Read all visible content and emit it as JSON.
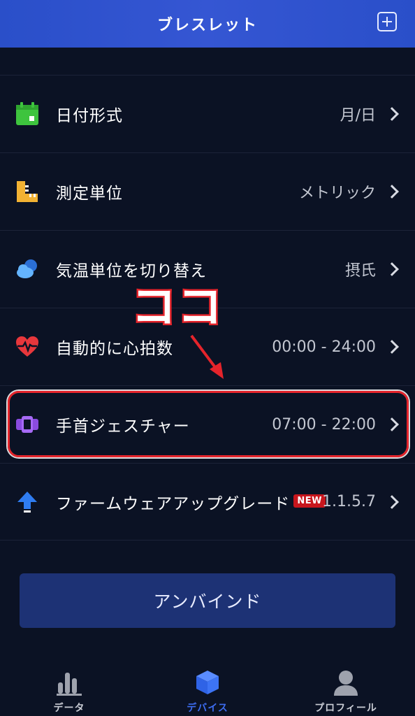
{
  "header": {
    "title": "ブレスレット"
  },
  "settings": [
    {
      "label": "日付形式",
      "value": "月/日",
      "icon": "calendar-icon"
    },
    {
      "label": "測定単位",
      "value": "メトリック",
      "icon": "ruler-icon"
    },
    {
      "label": "気温単位を切り替え",
      "value": "摂氏",
      "icon": "weather-cloud-icon"
    },
    {
      "label": "自動的に心拍数",
      "value": "00:00 - 24:00",
      "icon": "heart-rate-icon"
    },
    {
      "label": "手首ジェスチャー",
      "value": "07:00 - 22:00",
      "icon": "watch-icon"
    },
    {
      "label": "ファームウェアアップグレード",
      "value": "1.1.5.7",
      "badge": "NEW",
      "icon": "upload-arrow-icon"
    }
  ],
  "annotation": {
    "text": "ココ"
  },
  "unbind_button": {
    "label": "アンバインド"
  },
  "tabs": [
    {
      "label": "データ",
      "icon": "bar-chart-icon",
      "active": false
    },
    {
      "label": "デバイス",
      "icon": "cube-icon",
      "active": true
    },
    {
      "label": "プロフィール",
      "icon": "person-icon",
      "active": false
    }
  ],
  "colors": {
    "background": "#0b1224",
    "header": "#3556d3",
    "accent": "#3d6cf0",
    "highlight": "#e5242b",
    "button": "#1d3275"
  }
}
